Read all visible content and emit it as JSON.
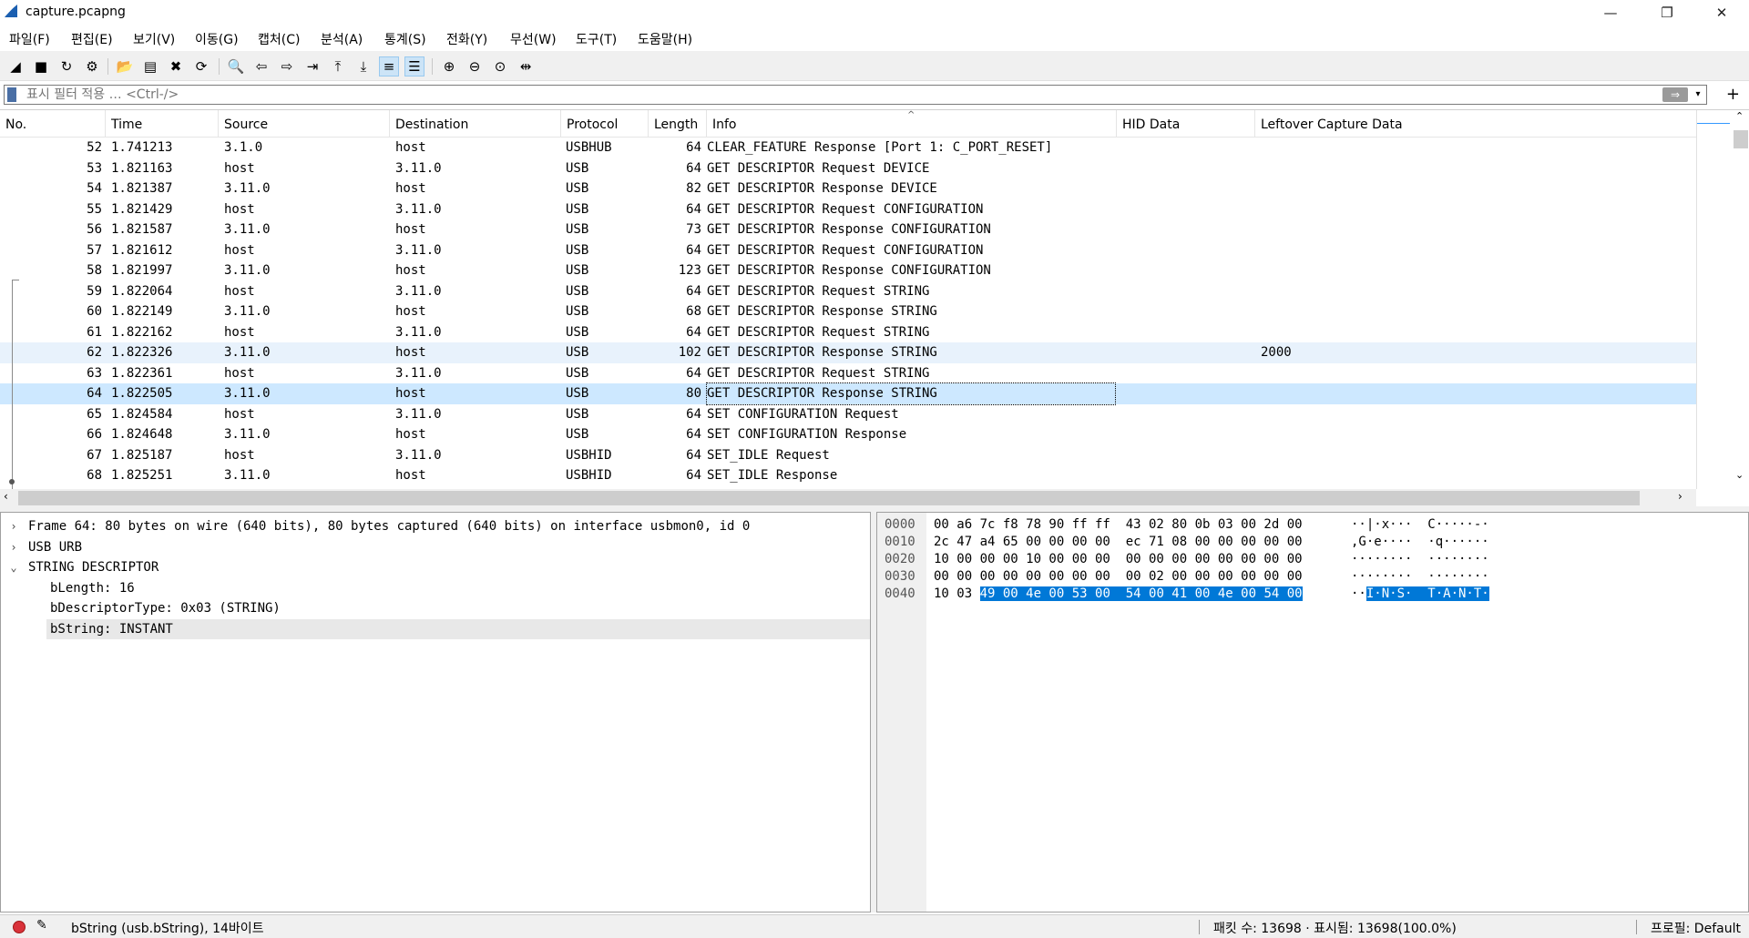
{
  "window": {
    "title": "capture.pcapng",
    "minimize": "—",
    "maximize": "❐",
    "close": "✕"
  },
  "menu": [
    "파일(F)",
    "편집(E)",
    "보기(V)",
    "이동(G)",
    "캡처(C)",
    "분석(A)",
    "통계(S)",
    "전화(Y)",
    "무선(W)",
    "도구(T)",
    "도움말(H)"
  ],
  "toolbar": {
    "icons": [
      "shark-fin-start-icon",
      "stop-icon",
      "restart-icon",
      "options-gear-icon",
      "open-folder-icon",
      "file-icon",
      "close-file-icon",
      "reload-icon",
      "find-icon",
      "go-back-icon",
      "go-forward-icon",
      "go-to-packet-icon",
      "first-packet-icon",
      "last-packet-icon",
      "autoscroll-icon",
      "colorize-icon",
      "zoom-in-icon",
      "zoom-out-icon",
      "zoom-normal-icon",
      "resize-columns-icon"
    ],
    "glyphs": [
      "◢",
      "■",
      "↻",
      "⚙",
      "📂",
      "▤",
      "✖",
      "⟳",
      "🔍",
      "⇦",
      "⇨",
      "⇥",
      "⤒",
      "⤓",
      "≡",
      "☰",
      "⊕",
      "⊖",
      "⊙",
      "⇹"
    ],
    "active": [
      14,
      15
    ]
  },
  "filter": {
    "placeholder": "표시 필터 적용 … <Ctrl-/>",
    "apply": "⇒",
    "dropdown": "▾",
    "add": "+"
  },
  "packet_list": {
    "columns": [
      "No.",
      "Time",
      "Source",
      "Destination",
      "Protocol",
      "Length",
      "Info",
      "HID Data",
      "Leftover Capture Data"
    ],
    "sort_indicator": "^",
    "rows": [
      {
        "no": "52",
        "time": "1.741213",
        "src": "3.1.0",
        "dst": "host",
        "proto": "USBHUB",
        "len": "64",
        "info": "CLEAR_FEATURE Response [Port 1: C_PORT_RESET]",
        "hid": "",
        "leftover": ""
      },
      {
        "no": "53",
        "time": "1.821163",
        "src": "host",
        "dst": "3.11.0",
        "proto": "USB",
        "len": "64",
        "info": "GET DESCRIPTOR Request DEVICE",
        "hid": "",
        "leftover": ""
      },
      {
        "no": "54",
        "time": "1.821387",
        "src": "3.11.0",
        "dst": "host",
        "proto": "USB",
        "len": "82",
        "info": "GET DESCRIPTOR Response DEVICE",
        "hid": "",
        "leftover": ""
      },
      {
        "no": "55",
        "time": "1.821429",
        "src": "host",
        "dst": "3.11.0",
        "proto": "USB",
        "len": "64",
        "info": "GET DESCRIPTOR Request CONFIGURATION",
        "hid": "",
        "leftover": ""
      },
      {
        "no": "56",
        "time": "1.821587",
        "src": "3.11.0",
        "dst": "host",
        "proto": "USB",
        "len": "73",
        "info": "GET DESCRIPTOR Response CONFIGURATION",
        "hid": "",
        "leftover": ""
      },
      {
        "no": "57",
        "time": "1.821612",
        "src": "host",
        "dst": "3.11.0",
        "proto": "USB",
        "len": "64",
        "info": "GET DESCRIPTOR Request CONFIGURATION",
        "hid": "",
        "leftover": ""
      },
      {
        "no": "58",
        "time": "1.821997",
        "src": "3.11.0",
        "dst": "host",
        "proto": "USB",
        "len": "123",
        "info": "GET DESCRIPTOR Response CONFIGURATION",
        "hid": "",
        "leftover": ""
      },
      {
        "no": "59",
        "time": "1.822064",
        "src": "host",
        "dst": "3.11.0",
        "proto": "USB",
        "len": "64",
        "info": "GET DESCRIPTOR Request STRING",
        "hid": "",
        "leftover": ""
      },
      {
        "no": "60",
        "time": "1.822149",
        "src": "3.11.0",
        "dst": "host",
        "proto": "USB",
        "len": "68",
        "info": "GET DESCRIPTOR Response STRING",
        "hid": "",
        "leftover": ""
      },
      {
        "no": "61",
        "time": "1.822162",
        "src": "host",
        "dst": "3.11.0",
        "proto": "USB",
        "len": "64",
        "info": "GET DESCRIPTOR Request STRING",
        "hid": "",
        "leftover": ""
      },
      {
        "no": "62",
        "time": "1.822326",
        "src": "3.11.0",
        "dst": "host",
        "proto": "USB",
        "len": "102",
        "info": "GET DESCRIPTOR Response STRING",
        "hid": "",
        "leftover": "2000"
      },
      {
        "no": "63",
        "time": "1.822361",
        "src": "host",
        "dst": "3.11.0",
        "proto": "USB",
        "len": "64",
        "info": "GET DESCRIPTOR Request STRING",
        "hid": "",
        "leftover": ""
      },
      {
        "no": "64",
        "time": "1.822505",
        "src": "3.11.0",
        "dst": "host",
        "proto": "USB",
        "len": "80",
        "info": "GET DESCRIPTOR Response STRING",
        "hid": "",
        "leftover": ""
      },
      {
        "no": "65",
        "time": "1.824584",
        "src": "host",
        "dst": "3.11.0",
        "proto": "USB",
        "len": "64",
        "info": "SET CONFIGURATION Request",
        "hid": "",
        "leftover": ""
      },
      {
        "no": "66",
        "time": "1.824648",
        "src": "3.11.0",
        "dst": "host",
        "proto": "USB",
        "len": "64",
        "info": "SET CONFIGURATION Response",
        "hid": "",
        "leftover": ""
      },
      {
        "no": "67",
        "time": "1.825187",
        "src": "host",
        "dst": "3.11.0",
        "proto": "USBHID",
        "len": "64",
        "info": "SET_IDLE Request",
        "hid": "",
        "leftover": ""
      },
      {
        "no": "68",
        "time": "1.825251",
        "src": "3.11.0",
        "dst": "host",
        "proto": "USBHID",
        "len": "64",
        "info": "SET_IDLE Response",
        "hid": "",
        "leftover": ""
      }
    ],
    "selected_no": "64",
    "alt_no": "62"
  },
  "details": {
    "rows": [
      {
        "twisty": "›",
        "text": "Frame 64: 80 bytes on wire (640 bits), 80 bytes captured (640 bits) on interface usbmon0, id 0"
      },
      {
        "twisty": "›",
        "text": "USB URB"
      },
      {
        "twisty": "⌄",
        "text": "STRING DESCRIPTOR"
      },
      {
        "twisty": "",
        "text": "bLength: 16"
      },
      {
        "twisty": "",
        "text": "bDescriptorType: 0x03 (STRING)"
      },
      {
        "twisty": "",
        "text": "bString: INSTANT"
      }
    ],
    "highlighted_index": 5
  },
  "bytes": {
    "lines": [
      {
        "offset": "0000",
        "hex_pre": "00 a6 7c f8 78 90 ff ff  43 02 80 0b 03 00 2d 00",
        "hex_sel": "",
        "hex_post": "",
        "ascii_pre": "··|·x···  C·····-·",
        "ascii_sel": "",
        "ascii_post": ""
      },
      {
        "offset": "0010",
        "hex_pre": "2c 47 a4 65 00 00 00 00  ec 71 08 00 00 00 00 00",
        "hex_sel": "",
        "hex_post": "",
        "ascii_pre": ",G·e····  ·q······",
        "ascii_sel": "",
        "ascii_post": ""
      },
      {
        "offset": "0020",
        "hex_pre": "10 00 00 00 10 00 00 00  00 00 00 00 00 00 00 00",
        "hex_sel": "",
        "hex_post": "",
        "ascii_pre": "········  ········",
        "ascii_sel": "",
        "ascii_post": ""
      },
      {
        "offset": "0030",
        "hex_pre": "00 00 00 00 00 00 00 00  00 02 00 00 00 00 00 00",
        "hex_sel": "",
        "hex_post": "",
        "ascii_pre": "········  ········",
        "ascii_sel": "",
        "ascii_post": ""
      },
      {
        "offset": "0040",
        "hex_pre": "10 03 ",
        "hex_sel": "49 00 4e 00 53 00  54 00 41 00 4e 00 54 00",
        "hex_post": "",
        "ascii_pre": "··",
        "ascii_sel": "I·N·S·  T·A·N·T·",
        "ascii_post": ""
      }
    ]
  },
  "status": {
    "field": "bString (usb.bString), 14바이트",
    "packets": "패킷 수: 13698 · 표시됨: 13698(100.0%)",
    "profile": "프로필: Default",
    "edit_glyph": "✎"
  },
  "colors": {
    "selected_row": "#cde8ff",
    "alt_row": "#e8f2fc",
    "byte_selection": "#0078d7",
    "status_led": "#d9323a"
  }
}
